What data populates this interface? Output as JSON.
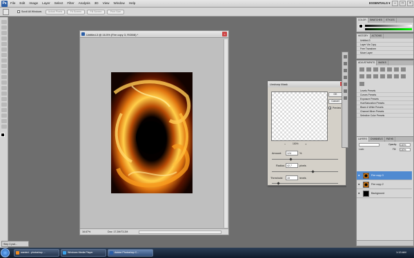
{
  "app": {
    "logo": "Ps",
    "menu": [
      "File",
      "Edit",
      "Image",
      "Layer",
      "Select",
      "Filter",
      "Analysis",
      "3D",
      "View",
      "Window",
      "Help"
    ],
    "workspace": "ESSENTIALS ▾",
    "window_controls": [
      "–",
      "□",
      "×"
    ]
  },
  "options_bar": {
    "checkbox_label": "Scroll All Windows",
    "buttons": [
      "Actual Pixels",
      "Fit Screen",
      "Fill Screen",
      "Print Size"
    ]
  },
  "document": {
    "title": "Untitled-3 @ 16.5% (Fire copy 3, RGB/8) *",
    "zoom": "16.67%",
    "doc_info": "Doc: 17.2M/73.2M"
  },
  "dialog": {
    "title": "Unsharp Mask",
    "ok_label": "OK",
    "cancel_label": "Cancel",
    "preview_label": "Preview",
    "preview_zoom": "100%",
    "amount_label": "Amount:",
    "amount_value": "124",
    "amount_unit": "%",
    "radius_label": "Radius:",
    "radius_value": "42.7",
    "radius_unit": "pixels",
    "threshold_label": "Threshold:",
    "threshold_value": "15",
    "threshold_unit": "levels"
  },
  "panels": {
    "color_tabs": [
      "COLOR",
      "SWATCHES",
      "STYLES"
    ],
    "history_tabs": [
      "HISTORY",
      "ACTIONS"
    ],
    "history_items": [
      "Untitled-3",
      "Layer Via Copy",
      "Free Transform",
      "Move Layer"
    ],
    "adjust_tabs": [
      "ADJUSTMENTS",
      "MASKS"
    ],
    "adjust_presets": [
      "Levels Presets",
      "Curves Presets",
      "Exposure Presets",
      "Hue/Saturation Presets",
      "Black & White Presets",
      "Channel Mixer Presets",
      "Selective Color Presets"
    ],
    "layers_tabs": [
      "LAYERS",
      "CHANNELS",
      "PATHS"
    ],
    "blend_mode": "Lock:",
    "opacity_label": "Opacity:",
    "opacity_value": "100%",
    "fill_label": "Fill:",
    "fill_value": "100%",
    "layers": [
      {
        "name": "Fire copy 3",
        "selected": true
      },
      {
        "name": "Fire copy 2",
        "selected": false
      },
      {
        "name": "Background",
        "selected": false
      }
    ]
  },
  "minimized_doc": "Step 2.psd...",
  "taskbar": {
    "tasks": [
      "wanted - photoshop ...",
      "Windows Media Player",
      "Adobe Photoshop C..."
    ],
    "clock": "1:13 AM"
  },
  "colors": {
    "accent": "#4f8ad1",
    "fire_orange": "#f08a12",
    "fire_yellow": "#ffd34a"
  }
}
